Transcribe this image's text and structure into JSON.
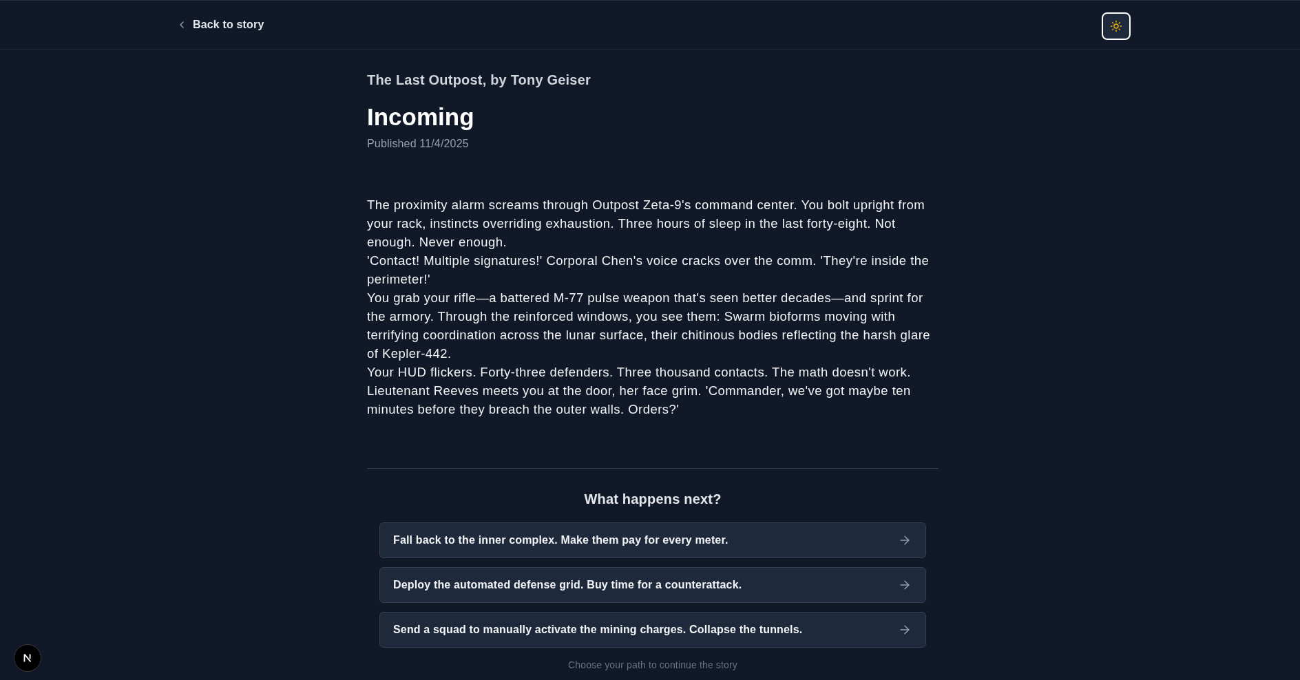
{
  "header": {
    "back_link": "Back to story"
  },
  "story": {
    "series_title": "The Last Outpost, by Tony Geiser",
    "chapter_title": "Incoming",
    "published": "Published 11/4/2025",
    "paragraphs": [
      "The proximity alarm screams through Outpost Zeta-9's command center. You bolt upright from your rack, instincts overriding exhaustion. Three hours of sleep in the last forty-eight. Not enough. Never enough.",
      "'Contact! Multiple signatures!' Corporal Chen's voice cracks over the comm. 'They're inside the perimeter!'",
      "You grab your rifle—a battered M-77 pulse weapon that's seen better decades—and sprint for the armory. Through the reinforced windows, you see them: Swarm bioforms moving with terrifying coordination across the lunar surface, their chitinous bodies reflecting the harsh glare of Kepler-442.",
      "Your HUD flickers. Forty-three defenders. Three thousand contacts. The math doesn't work.",
      "Lieutenant Reeves meets you at the door, her face grim. 'Commander, we've got maybe ten minutes before they breach the outer walls. Orders?'"
    ]
  },
  "choices": {
    "heading": "What happens next?",
    "options": [
      "Fall back to the inner complex. Make them pay for every meter.",
      "Deploy the automated defense grid. Buy time for a counterattack.",
      "Send a squad to manually activate the mining charges. Collapse the tunnels."
    ],
    "hint": "Choose your path to continue the story"
  }
}
